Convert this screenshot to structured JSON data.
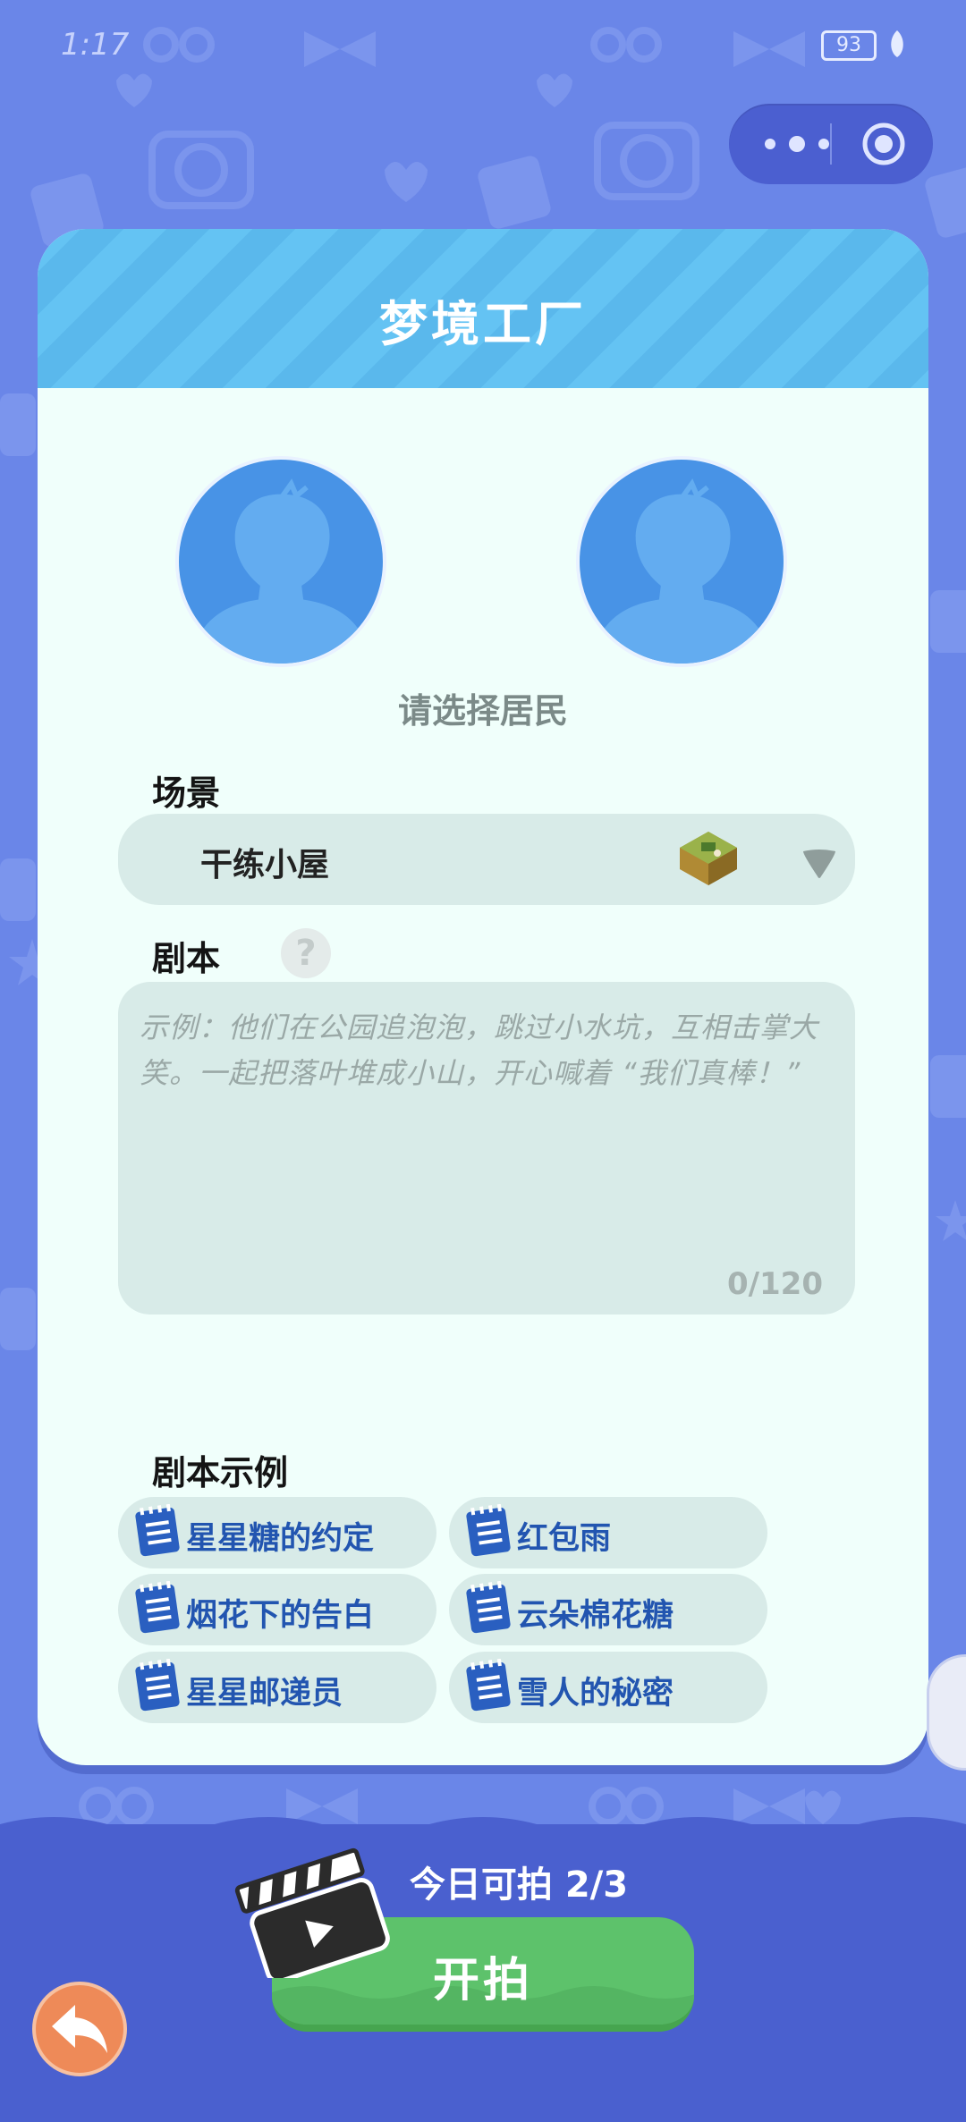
{
  "status_bar": {
    "time": "1:17",
    "battery": "93"
  },
  "card": {
    "title": "梦境工厂"
  },
  "residents": {
    "hint": "请选择居民"
  },
  "scene": {
    "label": "场景",
    "value": "干练小屋"
  },
  "script": {
    "label": "剧本",
    "help": "?",
    "placeholder": "示例：他们在公园追泡泡，跳过小水坑，互相击掌大笑。一起把落叶堆成小山，开心喊着 “我们真棒！”",
    "counter": "0/120"
  },
  "examples": {
    "label": "剧本示例",
    "items": [
      "星星糖的约定",
      "红包雨",
      "烟花下的告白",
      "云朵棉花糖",
      "星星邮递员",
      "雪人的秘密"
    ]
  },
  "footer": {
    "today": "今日可拍 2/3",
    "start": "开拍"
  },
  "colors": {
    "background": "#6a86e8",
    "card": "#f0fffb",
    "header_stripe": "#64c3f3",
    "chip_text": "#2255b0",
    "start_button": "#5dc26b",
    "back_button": "#ee8a58"
  },
  "icons": [
    "menu-dots-icon",
    "target-icon",
    "dropdown-triangle-icon",
    "help-icon",
    "script-book-icon",
    "clapperboard-icon",
    "back-arrow-icon"
  ]
}
